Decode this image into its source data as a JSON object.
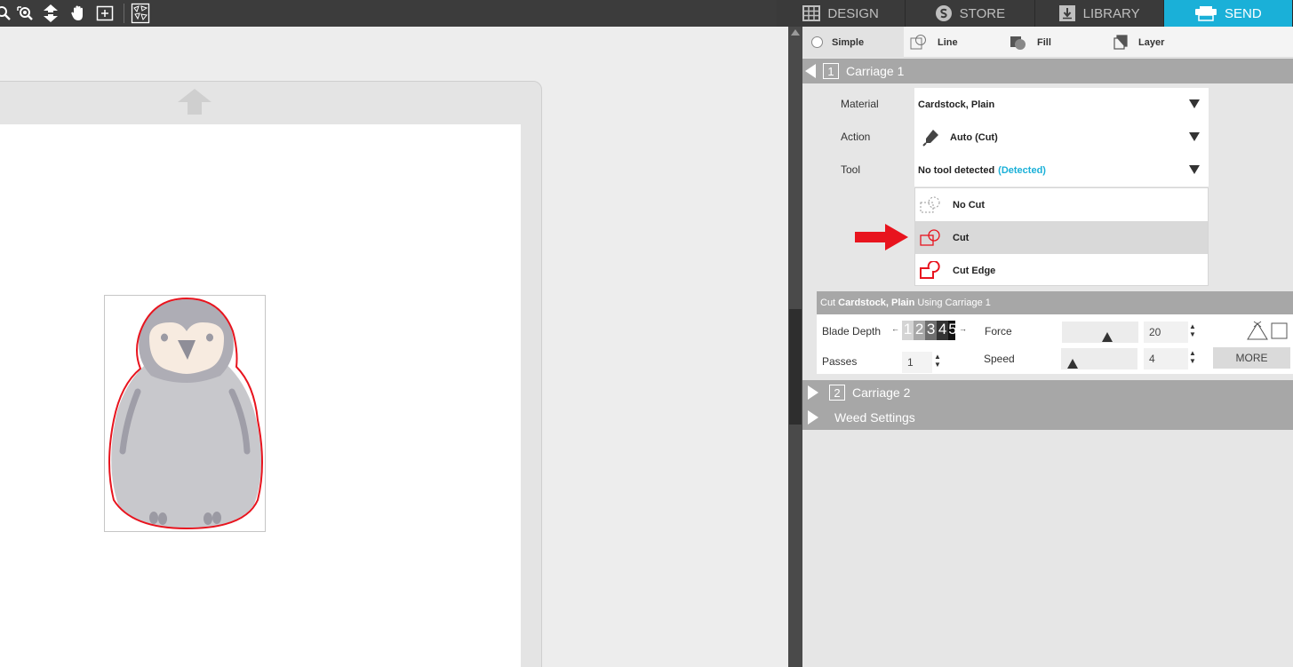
{
  "nav": {
    "tabs": [
      {
        "label": "DESIGN",
        "icon": "grid-icon"
      },
      {
        "label": "STORE",
        "icon": "store-s-icon"
      },
      {
        "label": "LIBRARY",
        "icon": "library-download-icon"
      },
      {
        "label": "SEND",
        "icon": "send-printer-icon",
        "active": true
      }
    ]
  },
  "modes": [
    {
      "label": "Simple",
      "icon": "radio-icon",
      "selected": true
    },
    {
      "label": "Line",
      "icon": "line-mode-icon"
    },
    {
      "label": "Fill",
      "icon": "fill-mode-icon"
    },
    {
      "label": "Layer",
      "icon": "layer-mode-icon"
    }
  ],
  "carriage1": {
    "number": "1",
    "title": "Carriage 1",
    "material_label": "Material",
    "material_value": "Cardstock, Plain",
    "action_label": "Action",
    "action_value": "Auto (Cut)",
    "tool_label": "Tool",
    "tool_value": "No tool detected",
    "tool_status": "(Detected)",
    "options": [
      {
        "label": "No Cut",
        "icon": "no-cut-icon"
      },
      {
        "label": "Cut",
        "icon": "cut-icon",
        "highlighted": true
      },
      {
        "label": "Cut Edge",
        "icon": "cut-edge-icon"
      }
    ]
  },
  "cut_settings": {
    "prefix": "Cut",
    "material": "Cardstock, Plain",
    "suffix": "Using Carriage 1",
    "blade_depth_label": "Blade Depth",
    "blade_depth_scale": [
      "1",
      "2",
      "3",
      "4",
      "5"
    ],
    "force_label": "Force",
    "force_value": "20",
    "passes_label": "Passes",
    "passes_value": "1",
    "speed_label": "Speed",
    "speed_value": "4",
    "more_label": "MORE"
  },
  "carriage2": {
    "number": "2",
    "title": "Carriage 2"
  },
  "weed": {
    "title": "Weed Settings"
  },
  "colors": {
    "accent": "#1ab0d8",
    "cut_line": "#e8141e",
    "section_bar": "#a7a7a7"
  }
}
